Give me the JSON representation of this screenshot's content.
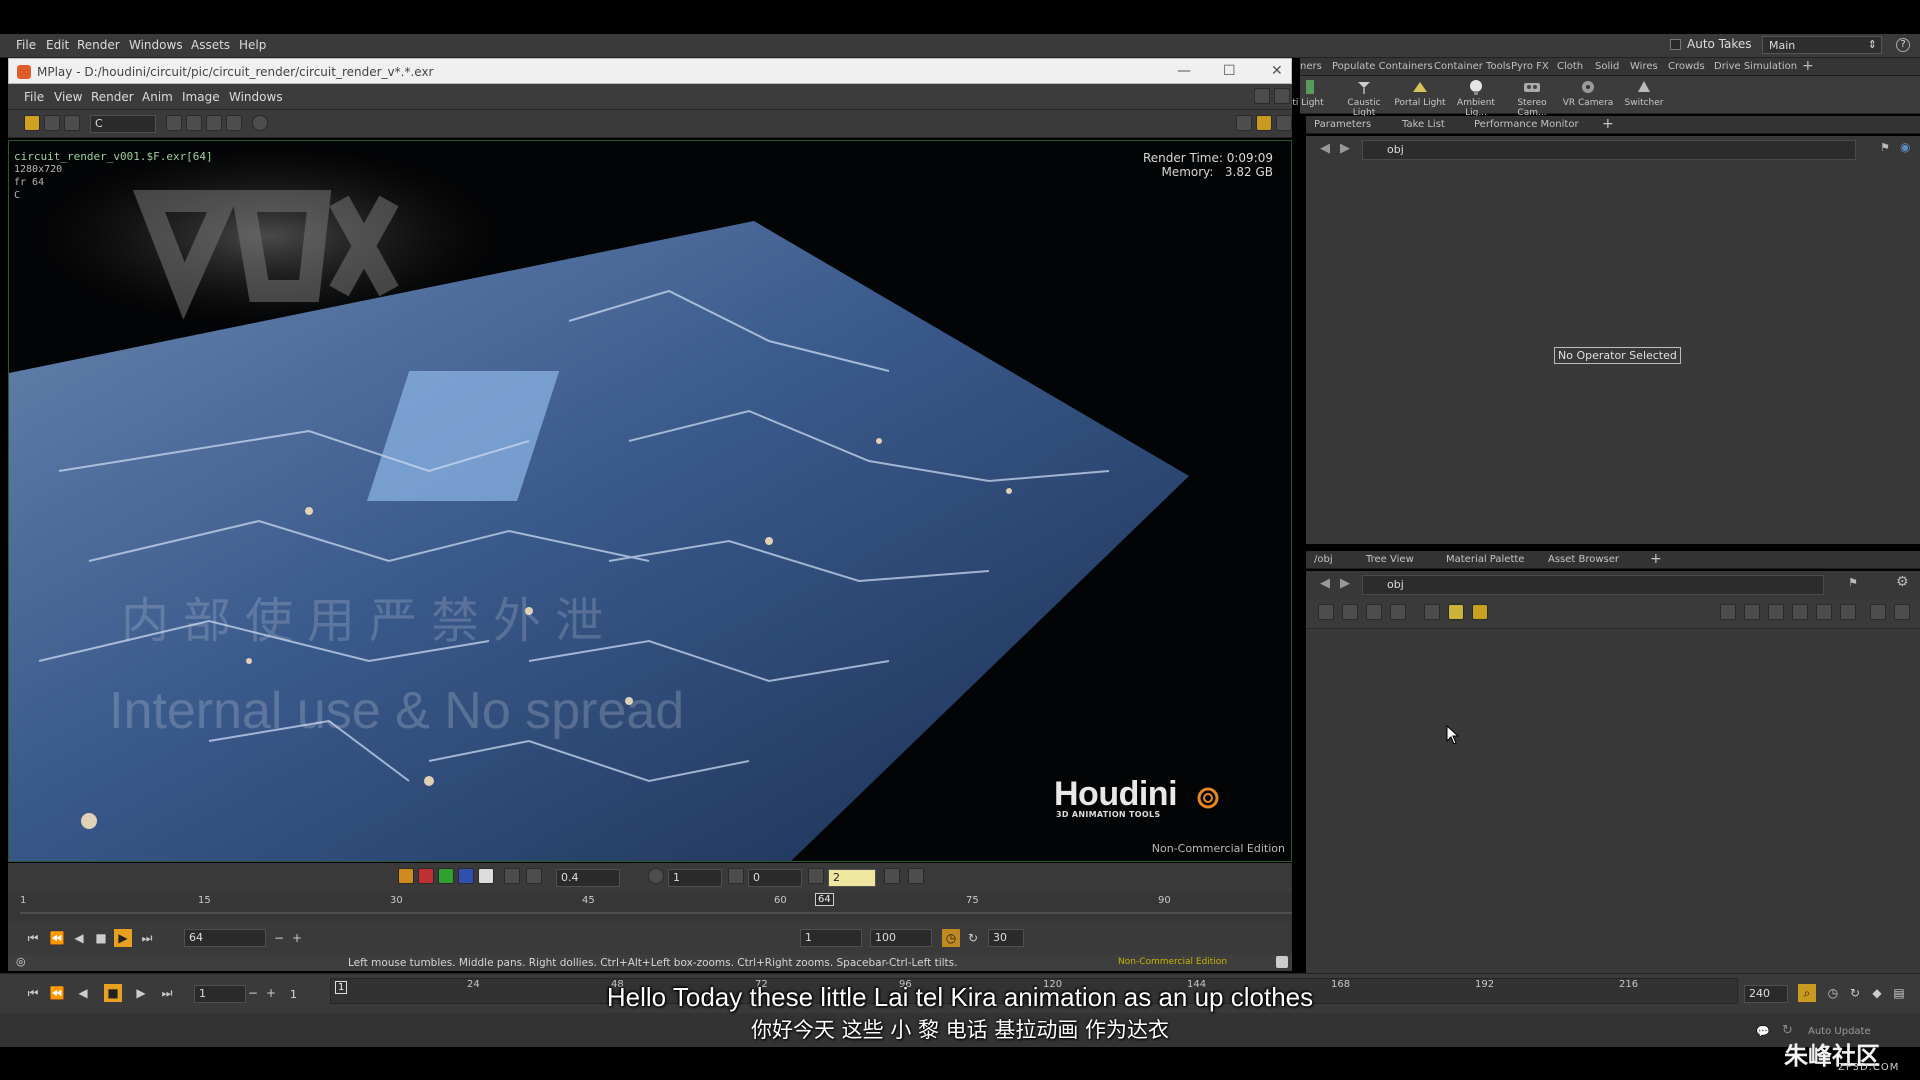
{
  "main_menu": [
    "File",
    "Edit",
    "Render",
    "Windows",
    "Assets",
    "Help"
  ],
  "auto_takes": "Auto Takes",
  "desktop": "Main",
  "help_glyph": "?",
  "shelf_tabs": [
    "ners",
    "Populate Containers",
    "Container Tools",
    "Pyro FX",
    "Cloth",
    "Solid",
    "Wires",
    "Crowds",
    "Drive Simulation"
  ],
  "shelf_tools": [
    "ti Light",
    "Caustic Light",
    "Portal Light",
    "Ambient Lig...",
    "Stereo Cam...",
    "VR Camera",
    "Switcher"
  ],
  "param_tabs": [
    "Parameters",
    "Take List",
    "Performance Monitor"
  ],
  "param_path": "obj",
  "no_operator": "No Operator Selected",
  "net_tabs": [
    "/obj",
    "Tree View",
    "Material Palette",
    "Asset Browser"
  ],
  "net_path": "obj",
  "mplay": {
    "title": "MPlay - D:/houdini/circuit/pic/circuit_render/circuit_render_v*.*.exr",
    "menu": [
      "File",
      "View",
      "Render",
      "Anim",
      "Image",
      "Windows"
    ],
    "channel": "C",
    "info_file": "circuit_render_v001.$F.exr[64]",
    "info_res": "1280x720",
    "info_frame": "fr 64",
    "info_chan": "C",
    "render_time_label": "Render Time:",
    "render_time": "0:09:09",
    "memory_label": "Memory:",
    "memory": "3.82 GB",
    "logo": "Houdini",
    "logo_sub": "3D ANIMATION TOOLS",
    "edition": "Non-Commercial Edition",
    "watermark_cn": "内部使用严禁外泄",
    "watermark_en": "Internal use & No spread",
    "gamma": "0.4",
    "exposure": "1",
    "offset": "0",
    "lut": "2",
    "ruler_ticks": [
      "1",
      "15",
      "30",
      "45",
      "60",
      "75",
      "90"
    ],
    "current_frame_marker": "64",
    "current_frame": "64",
    "range_start": "1",
    "range_end": "100",
    "fps": "30",
    "status": "Left mouse tumbles. Middle pans. Right dollies. Ctrl+Alt+Left box-zooms. Ctrl+Right zooms. Spacebar-Ctrl-Left tilts.",
    "status_warn": "Non-Commercial Edition"
  },
  "timeline": {
    "frame": "1",
    "start": "1",
    "marker": "1",
    "ticks": [
      "24",
      "48",
      "72",
      "96",
      "120",
      "144",
      "168",
      "192",
      "216"
    ],
    "end": "240",
    "auto_update": "Auto Update"
  },
  "subtitle_en": "Hello Today these little Lai tel Kira animation as an up clothes",
  "subtitle_cn": "你好今天 这些 小 黎 电话 基拉动画 作为达衣",
  "site_logo": "朱峰社区",
  "site_sub": "ZF3D.COM",
  "colors": {
    "accent_green": "#3a8a3a",
    "play_orange": "#e8a020",
    "yellow_field": "#efe6a0"
  }
}
